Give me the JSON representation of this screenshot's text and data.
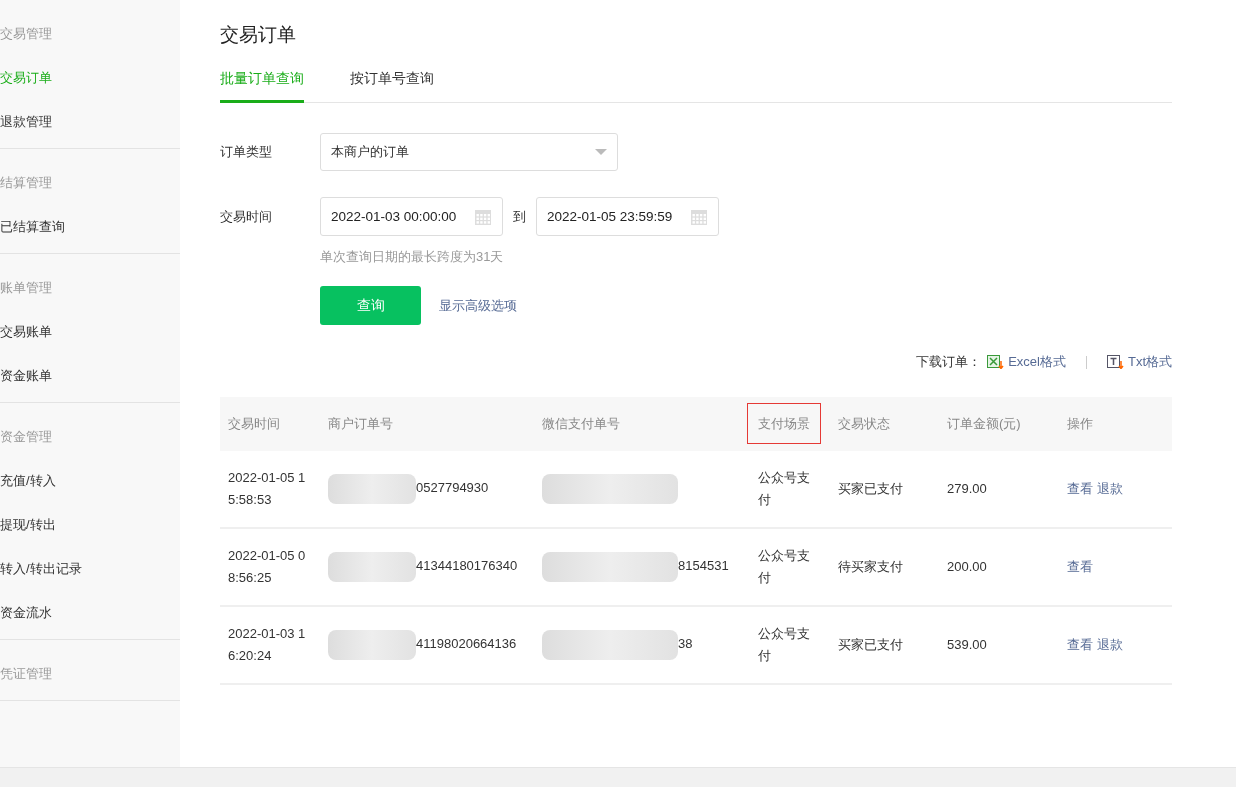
{
  "sidebar": {
    "groups": [
      {
        "title": "交易管理",
        "items": [
          {
            "label": "交易订单",
            "selected": true
          },
          {
            "label": "退款管理",
            "selected": false
          }
        ]
      },
      {
        "title": "结算管理",
        "items": [
          {
            "label": "已结算查询",
            "selected": false
          }
        ]
      },
      {
        "title": "账单管理",
        "items": [
          {
            "label": "交易账单",
            "selected": false
          },
          {
            "label": "资金账单",
            "selected": false
          }
        ]
      },
      {
        "title": "资金管理",
        "items": [
          {
            "label": "充值/转入",
            "selected": false
          },
          {
            "label": "提现/转出",
            "selected": false
          },
          {
            "label": "转入/转出记录",
            "selected": false
          },
          {
            "label": "资金流水",
            "selected": false
          }
        ]
      },
      {
        "title": "凭证管理"
      }
    ]
  },
  "page_title": "交易订单",
  "tabs": [
    {
      "label": "批量订单查询",
      "selected": true
    },
    {
      "label": "按订单号查询",
      "selected": false
    }
  ],
  "form": {
    "order_type": {
      "label": "订单类型",
      "value": "本商户的订单"
    },
    "time": {
      "label": "交易时间",
      "start": "2022-01-03 00:00:00",
      "separator": "到",
      "end": "2022-01-05 23:59:59",
      "hint": "单次查询日期的最长跨度为31天"
    },
    "query_button": "查询",
    "advanced_link": "显示高级选项"
  },
  "download": {
    "label": "下载订单：",
    "options": [
      {
        "kind": "excel",
        "label": "Excel格式"
      },
      {
        "kind": "txt",
        "label": "Txt格式"
      }
    ]
  },
  "table": {
    "columns": [
      {
        "label": "交易时间",
        "highlighted": false
      },
      {
        "label": "商户订单号",
        "highlighted": false
      },
      {
        "label": "微信支付单号",
        "highlighted": false
      },
      {
        "label": "支付场景",
        "highlighted": true
      },
      {
        "label": "交易状态",
        "highlighted": false
      },
      {
        "label": "订单金额(元)",
        "highlighted": false
      },
      {
        "label": "操作",
        "highlighted": false
      }
    ],
    "rows": [
      {
        "time": [
          "2022-01-05 1",
          "5:58:53"
        ],
        "merchant_no": "0527794930",
        "wechat_no": "",
        "scene": "公众号支付",
        "status": "买家已支付",
        "amount": "279.00",
        "actions": [
          "查看",
          "退款"
        ]
      },
      {
        "time": [
          "2022-01-05 0",
          "8:56:25"
        ],
        "merchant_no": "41344180176340",
        "wechat_no": "8154531",
        "scene": "公众号支付",
        "status": "待买家支付",
        "amount": "200.00",
        "actions": [
          "查看"
        ]
      },
      {
        "time": [
          "2022-01-03 1",
          "6:20:24"
        ],
        "merchant_no": "41198020664136",
        "wechat_no": "38",
        "scene": "公众号支付",
        "status": "买家已支付",
        "amount": "539.00",
        "actions": [
          "查看",
          "退款"
        ]
      }
    ]
  }
}
